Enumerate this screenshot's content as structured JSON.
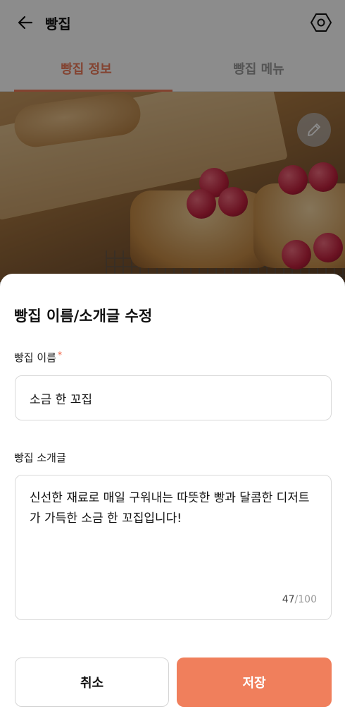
{
  "header": {
    "title": "빵집",
    "back_icon": "arrow-left-icon",
    "settings_icon": "hexagon-settings-icon"
  },
  "tabs": [
    {
      "label": "빵집 정보",
      "active": true
    },
    {
      "label": "빵집 메뉴",
      "active": false
    }
  ],
  "hero": {
    "edit_icon": "pencil-icon"
  },
  "sheet": {
    "title": "빵집 이름/소개글 수정",
    "name_label": "빵집 이름",
    "required_mark": "*",
    "name_value": "소금 한 꼬집",
    "intro_label": "빵집 소개글",
    "intro_value": "신선한 재료로 매일 구워내는 따뜻한 빵과 달콤한 디저트가 가득한 소금 한 꼬집입니다!",
    "char_count": "47",
    "char_max": "/100",
    "cancel_label": "취소",
    "save_label": "저장"
  },
  "colors": {
    "accent": "#ef7a5a",
    "save_button": "#f07f5c",
    "required": "#ef5a3a"
  }
}
